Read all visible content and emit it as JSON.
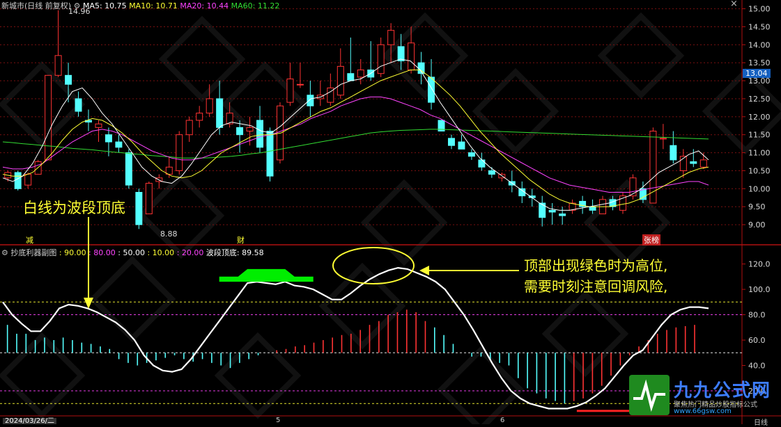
{
  "main_panel": {
    "stock_title": "新城市(日线 前复权)",
    "ma": [
      {
        "label": "MA5: 10.75",
        "color": "#ffffff"
      },
      {
        "label": "MA10: 10.71",
        "color": "#ffff33"
      },
      {
        "label": "MA20: 10.44",
        "color": "#ff44ff"
      },
      {
        "label": "MA60: 11.22",
        "color": "#33dd33"
      }
    ],
    "high_label": "14.96",
    "low_label": "8.88",
    "current_price": "13.04",
    "markers": [
      {
        "text": "减",
        "color": "#ffff33"
      },
      {
        "text": "财",
        "color": "#ffff33"
      },
      {
        "text": "张榜",
        "color": "#ffffff"
      }
    ]
  },
  "sub_panel": {
    "title": "抄底利器副图",
    "params": [
      {
        "label": ": 90.00",
        "color": "#ffff33"
      },
      {
        "label": ": 80.00",
        "color": "#ff44ff"
      },
      {
        "label": ": 50.00",
        "color": "#ffffff"
      },
      {
        "label": ": 10.00",
        "color": "#ffff33"
      },
      {
        "label": ": 20.00",
        "color": "#ff44ff"
      }
    ],
    "wave_label": "波段顶底: 89.58"
  },
  "annotations": {
    "white_line": "白线为波段顶底",
    "top_line1": "顶部出现绿色时为高位,",
    "top_line2": "需要时刻注意回调风险,"
  },
  "bottom": {
    "date": "2024/03/26/二",
    "period": "日线",
    "month_a": "5",
    "month_b": "6"
  },
  "logo": {
    "title": "九九公式网",
    "subtitle": "聚焦热门精品炒股指标公式",
    "url": "www.66gsw.com"
  },
  "colors": {
    "up": "#ff3333",
    "down": "#54ffff",
    "ma5": "#ffffff",
    "ma10": "#ffff33",
    "ma20": "#ff44ff",
    "ma60": "#33dd33",
    "top_zone": "#00ee00",
    "bottom_zone": "#ff2222",
    "wave": "#ffffff"
  },
  "chart_data": [
    {
      "type": "candlestick",
      "y_ticks": [
        9.0,
        9.5,
        10.0,
        10.5,
        11.0,
        11.5,
        12.0,
        12.5,
        13.0,
        13.5,
        14.0,
        14.5,
        15.0
      ],
      "ylim": [
        8.75,
        15.05
      ],
      "candles": [
        [
          10.3,
          10.5,
          10.2,
          10.45
        ],
        [
          10.45,
          10.5,
          9.95,
          10.0
        ],
        [
          10.1,
          10.45,
          10.0,
          10.4
        ],
        [
          10.4,
          10.8,
          10.4,
          10.75
        ],
        [
          10.8,
          13.15,
          10.8,
          13.15
        ],
        [
          13.15,
          14.96,
          13.1,
          13.7
        ],
        [
          13.15,
          13.5,
          12.4,
          12.9
        ],
        [
          12.5,
          12.7,
          12.0,
          12.15
        ],
        [
          11.9,
          12.2,
          11.6,
          11.85
        ],
        [
          11.7,
          11.9,
          11.3,
          11.8
        ],
        [
          11.5,
          11.7,
          10.9,
          11.3
        ],
        [
          11.3,
          11.5,
          11.0,
          11.15
        ],
        [
          11.0,
          11.1,
          10.0,
          10.1
        ],
        [
          9.9,
          10.0,
          8.88,
          9.0
        ],
        [
          9.3,
          10.2,
          9.3,
          10.15
        ],
        [
          10.2,
          10.4,
          10.0,
          10.3
        ],
        [
          10.4,
          10.9,
          10.3,
          10.6
        ],
        [
          10.5,
          11.6,
          10.4,
          11.5
        ],
        [
          11.5,
          12.0,
          11.3,
          11.9
        ],
        [
          11.9,
          12.3,
          11.7,
          12.1
        ],
        [
          12.1,
          12.9,
          12.0,
          12.5
        ],
        [
          12.5,
          13.0,
          11.5,
          11.7
        ],
        [
          11.8,
          12.4,
          11.7,
          12.1
        ],
        [
          11.7,
          11.9,
          11.0,
          11.5
        ],
        [
          11.6,
          12.0,
          11.2,
          11.7
        ],
        [
          11.9,
          12.3,
          11.0,
          11.15
        ],
        [
          11.6,
          11.7,
          10.2,
          10.35
        ],
        [
          10.8,
          12.4,
          10.7,
          12.3
        ],
        [
          12.4,
          13.5,
          12.3,
          13.05
        ],
        [
          12.9,
          13.5,
          12.8,
          12.9
        ],
        [
          12.6,
          13.0,
          12.0,
          12.3
        ],
        [
          12.5,
          13.0,
          12.3,
          12.6
        ],
        [
          12.4,
          13.2,
          12.3,
          12.8
        ],
        [
          12.6,
          13.9,
          12.5,
          13.4
        ],
        [
          13.2,
          14.2,
          13.0,
          13.0
        ],
        [
          13.1,
          13.6,
          12.9,
          13.3
        ],
        [
          13.3,
          14.1,
          13.0,
          13.1
        ],
        [
          13.2,
          14.2,
          13.1,
          14.0
        ],
        [
          14.0,
          14.6,
          13.5,
          14.4
        ],
        [
          13.95,
          14.3,
          13.3,
          13.55
        ],
        [
          13.3,
          14.5,
          13.2,
          14.05
        ],
        [
          13.5,
          13.8,
          12.9,
          13.2
        ],
        [
          13.1,
          13.6,
          12.2,
          12.4
        ],
        [
          11.9,
          11.9,
          11.6,
          11.6
        ],
        [
          11.4,
          11.5,
          11.1,
          11.2
        ],
        [
          11.3,
          11.5,
          11.1,
          11.1
        ],
        [
          11.0,
          11.1,
          10.8,
          10.9
        ],
        [
          10.8,
          11.0,
          10.5,
          10.6
        ],
        [
          10.5,
          10.6,
          10.3,
          10.4
        ],
        [
          10.3,
          10.45,
          10.2,
          10.4
        ],
        [
          10.2,
          10.5,
          9.9,
          10.1
        ],
        [
          10.0,
          10.2,
          9.6,
          9.8
        ],
        [
          9.8,
          10.0,
          9.5,
          9.75
        ],
        [
          9.6,
          9.8,
          8.95,
          9.2
        ],
        [
          9.4,
          9.6,
          9.0,
          9.35
        ],
        [
          9.3,
          9.5,
          9.0,
          9.25
        ],
        [
          9.4,
          9.7,
          9.3,
          9.6
        ],
        [
          9.65,
          9.8,
          9.3,
          9.5
        ],
        [
          9.5,
          9.7,
          9.3,
          9.4
        ],
        [
          9.3,
          9.8,
          9.3,
          9.7
        ],
        [
          9.7,
          9.8,
          9.4,
          9.5
        ],
        [
          9.4,
          9.9,
          9.3,
          9.8
        ],
        [
          9.8,
          10.4,
          9.7,
          10.3
        ],
        [
          10.0,
          10.2,
          9.6,
          9.7
        ],
        [
          9.6,
          11.7,
          9.6,
          11.6
        ],
        [
          11.4,
          11.8,
          11.1,
          11.4
        ],
        [
          11.2,
          11.6,
          10.7,
          10.8
        ],
        [
          10.5,
          11.1,
          10.3,
          10.9
        ],
        [
          10.75,
          11.1,
          10.6,
          10.7
        ],
        [
          10.6,
          11.0,
          10.55,
          10.8
        ]
      ],
      "ma5": [
        10.3,
        10.2,
        10.35,
        10.7,
        11.2,
        11.8,
        12.3,
        12.7,
        12.8,
        12.5,
        12.1,
        11.8,
        11.4,
        11.0,
        10.6,
        10.35,
        10.2,
        10.15,
        10.35,
        10.7,
        11.1,
        11.5,
        11.75,
        11.85,
        11.8,
        11.75,
        11.6,
        11.55,
        11.75,
        12.0,
        12.25,
        12.5,
        12.55,
        12.7,
        12.9,
        13.0,
        13.05,
        13.2,
        13.4,
        13.5,
        13.6,
        13.55,
        13.3,
        12.85,
        12.4,
        12.0,
        11.6,
        11.2,
        10.85,
        10.6,
        10.4,
        10.2,
        10.0,
        9.8,
        9.6,
        9.45,
        9.4,
        9.4,
        9.45,
        9.5,
        9.55,
        9.6,
        9.7,
        9.8,
        9.95,
        10.2,
        10.45,
        10.6,
        10.75,
        10.95,
        11.05,
        10.8
      ],
      "ma10": [
        10.4,
        10.35,
        10.35,
        10.45,
        10.7,
        11.0,
        11.35,
        11.65,
        11.85,
        11.95,
        11.9,
        11.75,
        11.55,
        11.3,
        11.0,
        10.75,
        10.5,
        10.35,
        10.3,
        10.35,
        10.5,
        10.75,
        11.0,
        11.15,
        11.3,
        11.45,
        11.5,
        11.5,
        11.55,
        11.7,
        11.85,
        12.0,
        12.15,
        12.25,
        12.4,
        12.55,
        12.7,
        12.85,
        13.0,
        13.1,
        13.2,
        13.3,
        13.3,
        13.1,
        12.85,
        12.6,
        12.3,
        11.95,
        11.6,
        11.3,
        11.0,
        10.75,
        10.5,
        10.25,
        10.05,
        9.85,
        9.7,
        9.6,
        9.55,
        9.5,
        9.5,
        9.5,
        9.55,
        9.6,
        9.7,
        9.85,
        10.0,
        10.15,
        10.3,
        10.45,
        10.55,
        10.6
      ],
      "ma20": [
        10.6,
        10.55,
        10.55,
        10.6,
        10.7,
        10.9,
        11.1,
        11.3,
        11.45,
        11.6,
        11.65,
        11.6,
        11.5,
        11.35,
        11.2,
        11.05,
        10.95,
        10.85,
        10.8,
        10.8,
        10.85,
        10.95,
        11.05,
        11.15,
        11.25,
        11.35,
        11.45,
        11.5,
        11.6,
        11.7,
        11.8,
        11.95,
        12.05,
        12.15,
        12.3,
        12.4,
        12.5,
        12.55,
        12.55,
        12.5,
        12.4,
        12.3,
        12.2,
        12.05,
        11.95,
        11.8,
        11.65,
        11.5,
        11.35,
        11.2,
        11.05,
        10.9,
        10.75,
        10.6,
        10.45,
        10.3,
        10.2,
        10.1,
        10.05,
        10.0,
        9.95,
        9.9,
        9.9,
        9.9,
        9.95,
        10.0,
        10.05,
        10.1,
        10.15,
        10.2,
        10.2,
        10.1
      ],
      "ma60": [
        11.3,
        11.28,
        11.25,
        11.23,
        11.2,
        11.18,
        11.15,
        11.12,
        11.1,
        11.08,
        11.05,
        11.02,
        11.0,
        10.97,
        10.95,
        10.92,
        10.9,
        10.88,
        10.85,
        10.85,
        10.85,
        10.86,
        10.88,
        10.9,
        10.93,
        10.97,
        11.0,
        11.05,
        11.1,
        11.15,
        11.2,
        11.25,
        11.3,
        11.35,
        11.4,
        11.45,
        11.5,
        11.55,
        11.58,
        11.6,
        11.62,
        11.63,
        11.64,
        11.65,
        11.65,
        11.64,
        11.63,
        11.62,
        11.61,
        11.6,
        11.59,
        11.58,
        11.57,
        11.56,
        11.55,
        11.54,
        11.53,
        11.52,
        11.51,
        11.5,
        11.49,
        11.48,
        11.47,
        11.46,
        11.45,
        11.44,
        11.43,
        11.42,
        11.41,
        11.4,
        11.39,
        11.38
      ]
    },
    {
      "type": "line",
      "y_ticks": [
        20.0,
        40.0,
        60.0,
        80.0,
        100.0,
        120.0
      ],
      "ylim": [
        3,
        128
      ],
      "reference_lines": [
        {
          "value": 90,
          "color": "#ffff33"
        },
        {
          "value": 80,
          "color": "#ff44ff"
        },
        {
          "value": 50,
          "color": "#ffffff"
        },
        {
          "value": 20,
          "color": "#ff44ff"
        },
        {
          "value": 10,
          "color": "#ffff33"
        }
      ],
      "wave": [
        90,
        80,
        73,
        67,
        67,
        75,
        85,
        88,
        87,
        85,
        82,
        78,
        74,
        68,
        60,
        48,
        40,
        36,
        35,
        37,
        45,
        55,
        65,
        75,
        85,
        95,
        105,
        106,
        105,
        104,
        106,
        103,
        102,
        100,
        96,
        92,
        92,
        97,
        103,
        108,
        112,
        115,
        117,
        116,
        113,
        110,
        106,
        100,
        90,
        80,
        68,
        55,
        42,
        30,
        20,
        14,
        10,
        8,
        6,
        6,
        6,
        8,
        11,
        16,
        22,
        31,
        40,
        48,
        52,
        62,
        72,
        80,
        84,
        86,
        86,
        85
      ],
      "histogram": [
        72,
        65,
        65,
        60,
        62,
        60,
        62,
        60,
        58,
        57,
        55,
        53,
        45,
        42,
        40,
        42,
        44,
        46,
        48,
        45,
        43,
        45,
        42,
        40,
        38,
        42,
        45,
        48,
        50,
        52,
        53,
        55,
        56,
        58,
        60,
        62,
        64,
        65,
        68,
        72,
        75,
        80,
        82,
        84,
        82,
        75,
        70,
        64,
        57,
        50,
        47,
        47,
        44,
        42,
        40,
        30,
        22,
        18,
        14,
        12,
        10,
        12,
        14,
        18,
        24,
        32,
        40,
        48,
        55,
        60,
        65,
        68,
        70,
        71,
        72,
        50
      ],
      "top_zone_range": [
        23,
        33
      ],
      "bottom_zone_range": [
        61,
        69
      ]
    }
  ]
}
